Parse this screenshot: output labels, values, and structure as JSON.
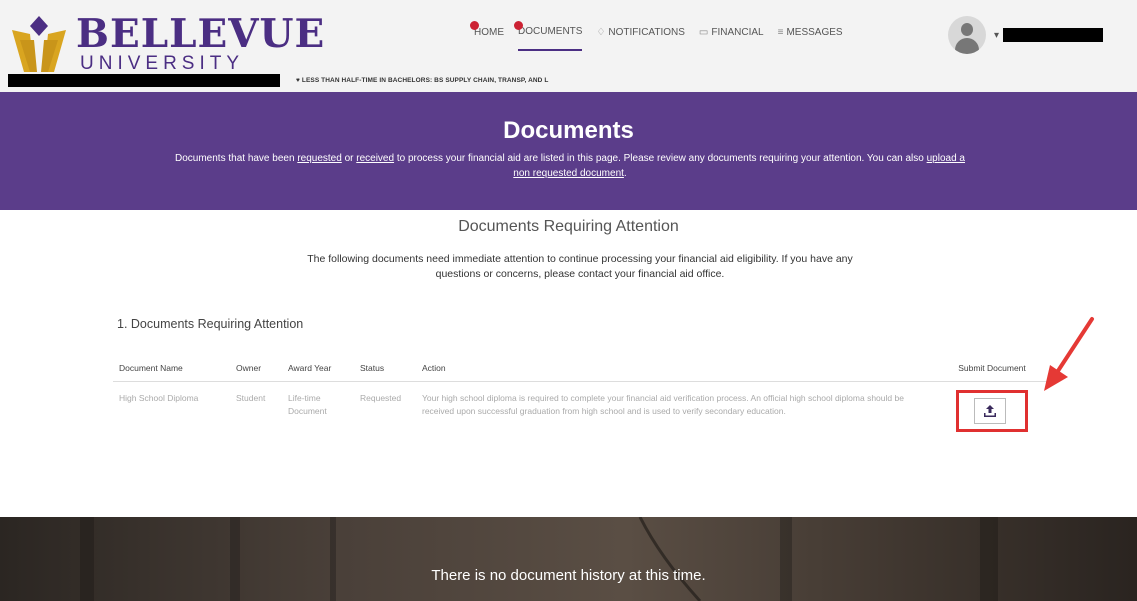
{
  "logo": {
    "title": "BELLEVUE",
    "subtitle": "UNIVERSITY"
  },
  "nav": [
    {
      "label": "HOME",
      "icon": "home-icon",
      "badge": true
    },
    {
      "label": "DOCUMENTS",
      "icon": "documents-icon",
      "badge": true,
      "active": true
    },
    {
      "label": "NOTIFICATIONS",
      "icon": "bell-icon",
      "badge": false
    },
    {
      "label": "FINANCIAL",
      "icon": "card-icon",
      "badge": false
    },
    {
      "label": "MESSAGES",
      "icon": "messages-icon",
      "badge": false
    }
  ],
  "program": "LESS THAN HALF-TIME IN BACHELORS: BS SUPPLY CHAIN, TRANSP, AND L",
  "banner": {
    "title": "Documents",
    "text_1": "Documents that have been ",
    "link_requested": "requested",
    "text_2": " or ",
    "link_received": "received",
    "text_3": " to process your financial aid are listed in this page. Please review any documents requiring your attention. You can also ",
    "link_upload": "upload a non requested document",
    "text_4": "."
  },
  "section": {
    "title": "Documents Requiring Attention",
    "description": "The following documents need immediate attention to continue processing your financial aid eligibility. If you have any questions or concerns, please contact your financial aid office.",
    "subtitle": "1. Documents Requiring Attention"
  },
  "table": {
    "headers": [
      "Document Name",
      "Owner",
      "Award Year",
      "Status",
      "Action",
      "Submit Document"
    ],
    "rows": [
      {
        "document_name": "High School Diploma",
        "owner": "Student",
        "award_year": "Life-time Document",
        "status": "Requested",
        "action": "Your high school diploma is required to complete your financial aid verification process. An official high school diploma should be received upon successful graduation from high school and is used to verify secondary education."
      }
    ]
  },
  "footer": {
    "message": "There is no document history at this time."
  },
  "colors": {
    "brand": "#4b2e83",
    "banner": "#5b3d8a",
    "highlight": "#e03030"
  }
}
